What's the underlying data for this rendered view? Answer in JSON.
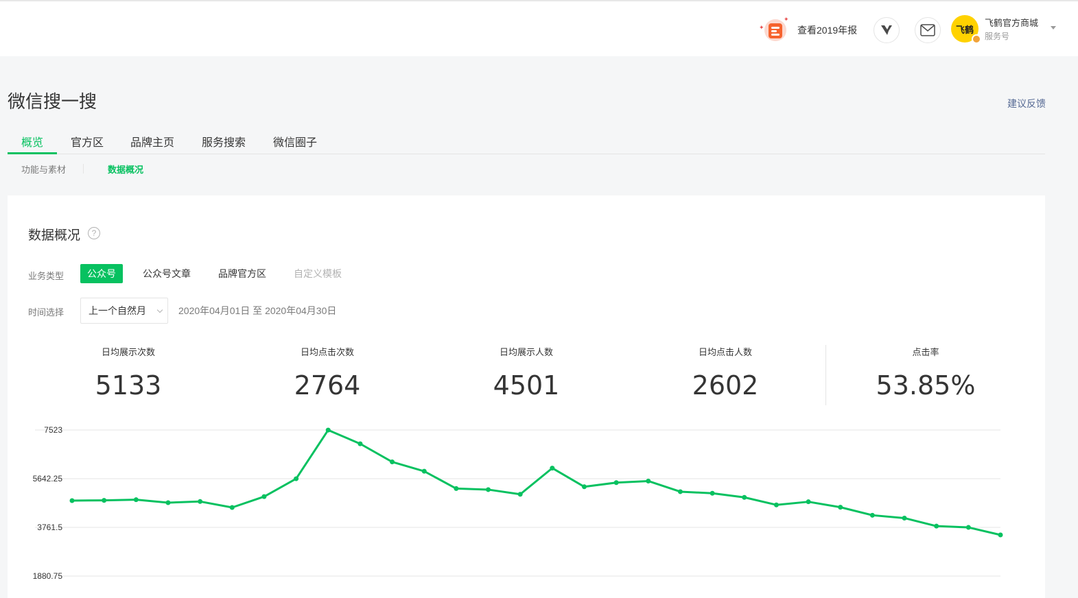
{
  "header": {
    "annual_report_label": "查看2019年报",
    "account_logo_text": "飞鹤",
    "account_name": "飞鹤官方商城",
    "account_type": "服务号"
  },
  "page": {
    "title": "微信搜一搜",
    "feedback_link": "建议反馈"
  },
  "tabs": [
    "概览",
    "官方区",
    "品牌主页",
    "服务搜索",
    "微信圈子"
  ],
  "active_tab": "概览",
  "subtabs": [
    "功能与素材",
    "数据概况"
  ],
  "active_subtab": "数据概况",
  "overview": {
    "title": "数据概况",
    "help_glyph": "?",
    "business_type_label": "业务类型",
    "business_types": [
      "公众号",
      "公众号文章",
      "品牌官方区",
      "自定义模板"
    ],
    "active_business_type": "公众号",
    "disabled_business_type": "自定义模板",
    "time_label": "时间选择",
    "time_select_value": "上一个自然月",
    "date_range": "2020年04月01日 至 2020年04月30日"
  },
  "stats": [
    {
      "label": "日均展示次数",
      "value": "5133"
    },
    {
      "label": "日均点击次数",
      "value": "2764"
    },
    {
      "label": "日均展示人数",
      "value": "4501"
    },
    {
      "label": "日均点击人数",
      "value": "2602"
    },
    {
      "label": "点击率",
      "value": "53.85%"
    }
  ],
  "colors": {
    "accent": "#07c160",
    "link": "#576b95"
  },
  "chart_data": {
    "type": "line",
    "title": "",
    "xlabel": "",
    "ylabel": "",
    "ylim": [
      1880.75,
      7523
    ],
    "yticks": [
      "7523",
      "5642.25",
      "3761.5",
      "1880.75"
    ],
    "ytick_values": [
      7523,
      5642.25,
      3761.5,
      1880.75
    ],
    "grid": true,
    "color": "#07c160",
    "values": [
      4795,
      4805,
      4830,
      4715,
      4760,
      4530,
      4950,
      5640,
      7520,
      6990,
      6290,
      5930,
      5260,
      5220,
      5040,
      6050,
      5330,
      5490,
      5550,
      5140,
      5080,
      4920,
      4630,
      4750,
      4540,
      4230,
      4120,
      3810,
      3760,
      3470
    ]
  }
}
